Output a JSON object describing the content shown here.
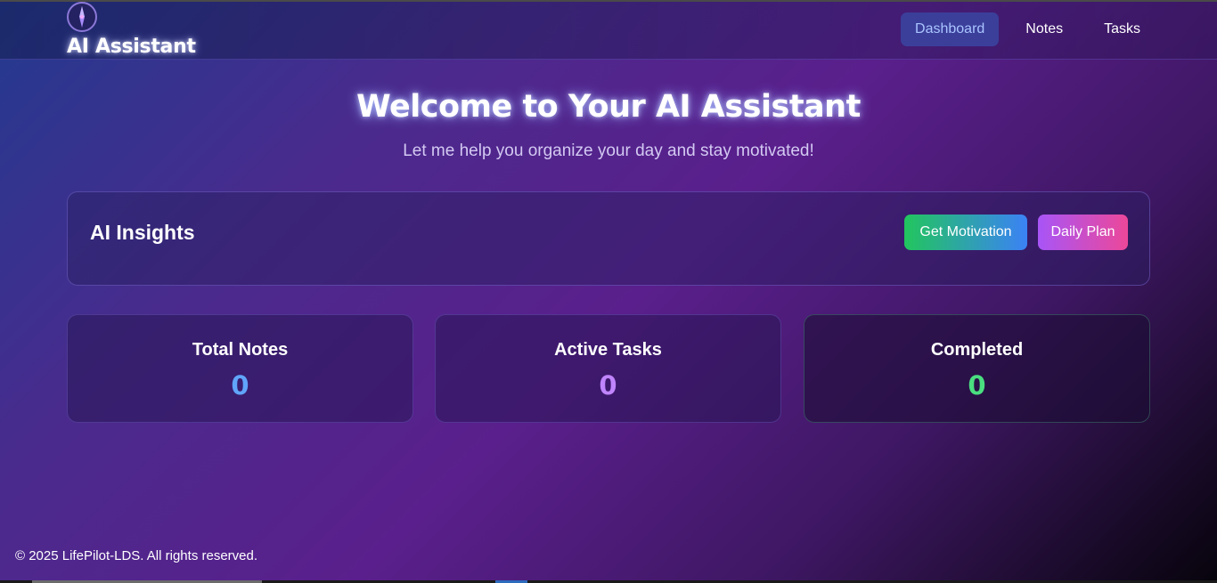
{
  "brand": {
    "title": "AI Assistant",
    "logo_icon": "compass-icon"
  },
  "nav": {
    "items": [
      {
        "label": "Dashboard",
        "active": true
      },
      {
        "label": "Notes",
        "active": false
      },
      {
        "label": "Tasks",
        "active": false
      }
    ]
  },
  "hero": {
    "title": "Welcome to Your AI Assistant",
    "subtitle": "Let me help you organize your day and stay motivated!"
  },
  "insights": {
    "title": "AI Insights",
    "motivation_button": "Get Motivation",
    "plan_button": "Daily Plan"
  },
  "stats": [
    {
      "label": "Total Notes",
      "value": "0",
      "color": "#60a5fa"
    },
    {
      "label": "Active Tasks",
      "value": "0",
      "color": "#c084fc"
    },
    {
      "label": "Completed",
      "value": "0",
      "color": "#4ade80"
    }
  ],
  "footer": {
    "text": "© 2025 LifePilot-LDS. All rights reserved."
  }
}
